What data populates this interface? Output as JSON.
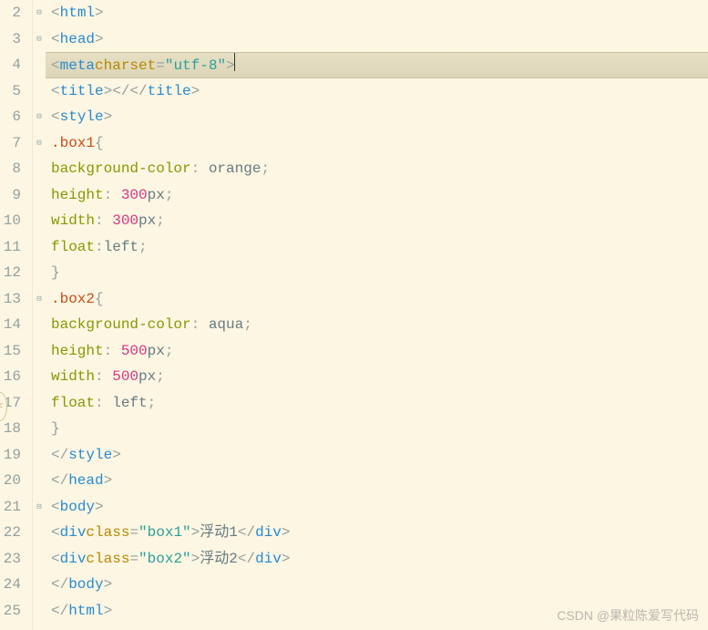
{
  "lineNumbers": [
    "2",
    "3",
    "4",
    "5",
    "6",
    "7",
    "8",
    "9",
    "10",
    "11",
    "12",
    "13",
    "14",
    "15",
    "16",
    "17",
    "18",
    "19",
    "20",
    "21",
    "22",
    "23",
    "24",
    "25"
  ],
  "foldMarkers": [
    "⊟",
    "⊟",
    "",
    "",
    "⊟",
    "⊟",
    "",
    "",
    "",
    "",
    "",
    "⊟",
    "",
    "",
    "",
    "",
    "",
    "",
    "",
    "⊟",
    "",
    "",
    "",
    ""
  ],
  "highlightedLine": 4,
  "code": {
    "l2": {
      "indent": "",
      "open": "<",
      "tag": "html",
      "close": ">"
    },
    "l3": {
      "indent": "    ",
      "open": "<",
      "tag": "head",
      "close": ">"
    },
    "l4": {
      "indent": "        ",
      "open": "<",
      "tag": "meta",
      "sp": " ",
      "attr": "charset",
      "eq": "=",
      "val": "\"utf-8\"",
      "close": ">"
    },
    "l5": {
      "indent": "        ",
      "open": "<",
      "tag": "title",
      "close": "></",
      "tag2": "title",
      "close2": ">"
    },
    "l6": {
      "indent": "        ",
      "open": "<",
      "tag": "style",
      "close": ">"
    },
    "l7": {
      "indent": "            ",
      "sel": ".box1",
      "brace": "{"
    },
    "l8": {
      "indent": "                ",
      "prop": "background-color",
      "colon": ": ",
      "val": "orange",
      "semi": ";"
    },
    "l9": {
      "indent": "                ",
      "prop": "height",
      "colon": ": ",
      "num": "300",
      "unit": "px",
      "semi": ";"
    },
    "l10": {
      "indent": "                ",
      "prop": "width",
      "colon": ": ",
      "num": "300",
      "unit": "px",
      "semi": ";"
    },
    "l11": {
      "indent": "                ",
      "prop": "float",
      "colon": ":",
      "val": "left",
      "semi": ";"
    },
    "l12": {
      "indent": "            ",
      "brace": "}"
    },
    "l13": {
      "indent": "            ",
      "sel": ".box2",
      "brace": "{"
    },
    "l14": {
      "indent": "                ",
      "prop": "background-color",
      "colon": ": ",
      "val": "aqua",
      "semi": ";"
    },
    "l15": {
      "indent": "                ",
      "prop": "height",
      "colon": ": ",
      "num": "500",
      "unit": "px",
      "semi": ";"
    },
    "l16": {
      "indent": "                ",
      "prop": "width",
      "colon": ": ",
      "num": "500",
      "unit": "px",
      "semi": ";"
    },
    "l17": {
      "indent": "                ",
      "prop": "float",
      "colon": ": ",
      "val": "left",
      "semi": ";"
    },
    "l18": {
      "indent": "            ",
      "brace": "}"
    },
    "l19": {
      "indent": "        ",
      "open": "</",
      "tag": "style",
      "close": ">"
    },
    "l20": {
      "indent": "    ",
      "open": "</",
      "tag": "head",
      "close": ">"
    },
    "l21": {
      "indent": "    ",
      "open": "<",
      "tag": "body",
      "close": ">"
    },
    "l22": {
      "indent": "        ",
      "open": "<",
      "tag": "div",
      "sp": " ",
      "attr": "class",
      "eq": "=",
      "val": "\"box1\"",
      "close": ">",
      "text": "浮动1",
      "open2": "</",
      "tag2": "div",
      "close2": ">"
    },
    "l23": {
      "indent": "        ",
      "open": "<",
      "tag": "div",
      "sp": " ",
      "attr": "class",
      "eq": "=",
      "val": "\"box2\"",
      "close": ">",
      "text": "浮动2",
      "open2": "</",
      "tag2": "div",
      "close2": ">"
    },
    "l24": {
      "indent": "    ",
      "open": "</",
      "tag": "body",
      "close": ">"
    },
    "l25": {
      "indent": "",
      "open": "</",
      "tag": "html",
      "close": ">"
    }
  },
  "watermark": "CSDN @果粒陈爱写代码",
  "leftHandle": "<"
}
